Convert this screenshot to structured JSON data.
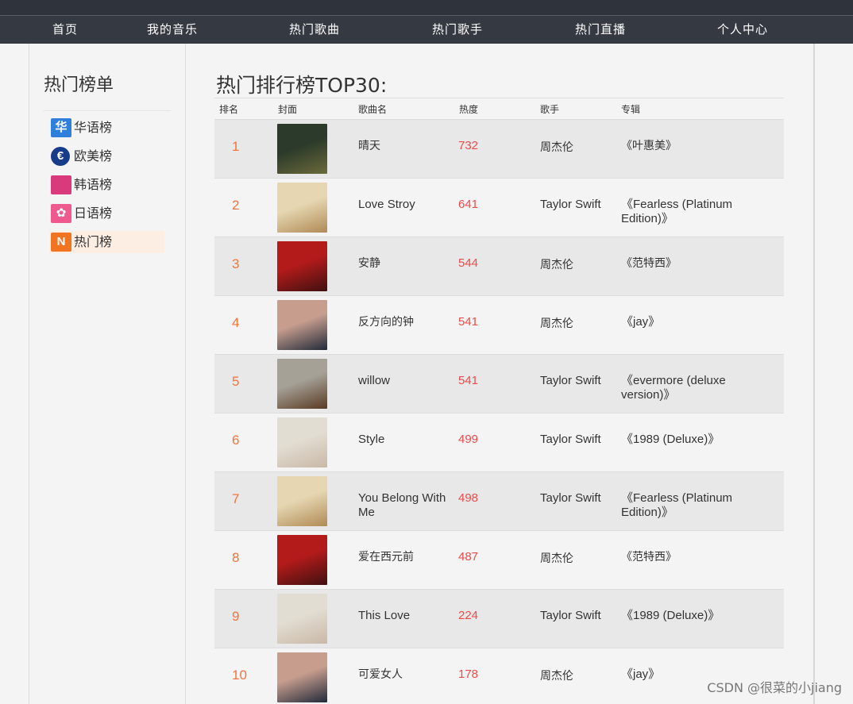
{
  "nav": {
    "items": [
      "首页",
      "我的音乐",
      "热门歌曲",
      "热门歌手",
      "热门直播",
      "个人中心"
    ]
  },
  "sidebar": {
    "title": "热门榜单",
    "items": [
      {
        "label": "华语榜",
        "icon": "chinese-chart-icon",
        "icon_text": "华",
        "color": "#2f7fdc"
      },
      {
        "label": "欧美榜",
        "icon": "euro-chart-icon",
        "icon_text": "€",
        "color": "#173d8a"
      },
      {
        "label": "韩语榜",
        "icon": "korean-chart-icon",
        "icon_text": "",
        "color": "#d93a7b"
      },
      {
        "label": "日语榜",
        "icon": "sakura-chart-icon",
        "icon_text": "✿",
        "color": "#ee5a8e"
      },
      {
        "label": "热门榜",
        "icon": "hot-chart-icon",
        "icon_text": "N",
        "color": "#f07422",
        "active": true
      }
    ]
  },
  "main": {
    "title": "热门排行榜TOP30:",
    "headers": {
      "rank": "排名",
      "cover": "封面",
      "name": "歌曲名",
      "heat": "热度",
      "singer": "歌手",
      "album": "专辑"
    },
    "rows": [
      {
        "rank": "1",
        "name": "晴天",
        "heat": "732",
        "singer": "周杰伦",
        "album": "《叶惠美》",
        "cover": "cover-ye-hui-mei",
        "cover_colors": [
          "#2b3a2a",
          "#6b6a3a"
        ]
      },
      {
        "rank": "2",
        "name": "Love Stroy",
        "heat": "641",
        "singer": "Taylor Swift",
        "album": "《Fearless (Platinum Edition)》",
        "cover": "cover-fearless-platinum",
        "cover_colors": [
          "#e6d7b2",
          "#b08a55"
        ]
      },
      {
        "rank": "3",
        "name": "安静",
        "heat": "544",
        "singer": "周杰伦",
        "album": "《范特西》",
        "cover": "cover-fantasy",
        "cover_colors": [
          "#b31b1b",
          "#401010"
        ]
      },
      {
        "rank": "4",
        "name": "反方向的钟",
        "heat": "541",
        "singer": "周杰伦",
        "album": "《jay》",
        "cover": "cover-jay",
        "cover_colors": [
          "#c79e8e",
          "#222a3a"
        ]
      },
      {
        "rank": "5",
        "name": "willow",
        "heat": "541",
        "singer": "Taylor Swift",
        "album": "《evermore (deluxe version)》",
        "cover": "cover-evermore",
        "cover_colors": [
          "#a5a197",
          "#5a3a22"
        ]
      },
      {
        "rank": "6",
        "name": "Style",
        "heat": "499",
        "singer": "Taylor Swift",
        "album": "《1989 (Deluxe)》",
        "cover": "cover-1989",
        "cover_colors": [
          "#e2ddd2",
          "#c9b8a6"
        ]
      },
      {
        "rank": "7",
        "name": "You Belong With Me",
        "heat": "498",
        "singer": "Taylor Swift",
        "album": "《Fearless (Platinum Edition)》",
        "cover": "cover-fearless-platinum",
        "cover_colors": [
          "#e6d7b2",
          "#b08a55"
        ]
      },
      {
        "rank": "8",
        "name": "爱在西元前",
        "heat": "487",
        "singer": "周杰伦",
        "album": "《范特西》",
        "cover": "cover-fantasy",
        "cover_colors": [
          "#b31b1b",
          "#401010"
        ]
      },
      {
        "rank": "9",
        "name": "This Love",
        "heat": "224",
        "singer": "Taylor Swift",
        "album": "《1989 (Deluxe)》",
        "cover": "cover-1989",
        "cover_colors": [
          "#e2ddd2",
          "#c9b8a6"
        ]
      },
      {
        "rank": "10",
        "name": "可爱女人",
        "heat": "178",
        "singer": "周杰伦",
        "album": "《jay》",
        "cover": "cover-jay",
        "cover_colors": [
          "#c79e8e",
          "#222a3a"
        ]
      }
    ]
  },
  "watermark": "CSDN @很菜的小jiang"
}
